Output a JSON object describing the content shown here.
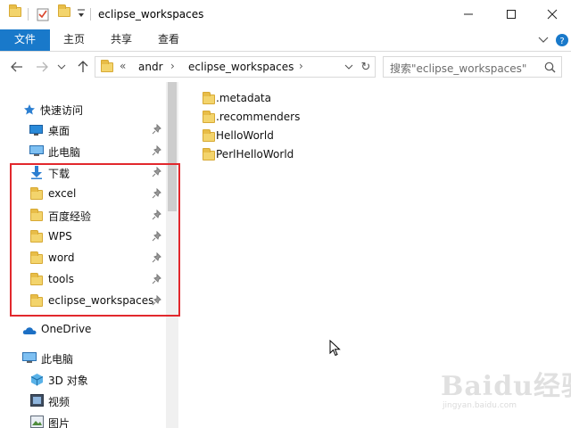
{
  "window": {
    "title": "eclipse_workspaces",
    "minimize_glyph": "—",
    "maximize_glyph": "☐",
    "close_glyph": "✕"
  },
  "ribbon": {
    "tabs": [
      "文件",
      "主页",
      "共享",
      "查看"
    ],
    "active_tab": "文件",
    "file_tab_color": "#1979ca"
  },
  "address": {
    "overflow_glyph": "«",
    "crumbs": [
      "andr",
      "eclipse_workspaces"
    ],
    "separator": "›",
    "refresh_glyph": "↻"
  },
  "search": {
    "placeholder": "搜索\"eclipse_workspaces\""
  },
  "nav_pane": {
    "quick_access_label": "快速访问",
    "quick_access_items": [
      {
        "label": "桌面",
        "icon": "desktop-icon",
        "pinned": true
      },
      {
        "label": "此电脑",
        "icon": "computer-icon",
        "pinned": true
      },
      {
        "label": "下载",
        "icon": "download-icon",
        "pinned": true
      },
      {
        "label": "excel",
        "icon": "folder-icon",
        "pinned": true
      },
      {
        "label": "百度经验",
        "icon": "folder-icon",
        "pinned": true
      },
      {
        "label": "WPS",
        "icon": "folder-icon",
        "pinned": true
      },
      {
        "label": "word",
        "icon": "folder-icon",
        "pinned": true
      },
      {
        "label": "tools",
        "icon": "folder-icon",
        "pinned": true
      },
      {
        "label": "eclipse_workspaces",
        "icon": "folder-icon",
        "pinned": true
      }
    ],
    "onedrive_label": "OneDrive",
    "this_pc_label": "此电脑",
    "this_pc_items": [
      {
        "label": "3D 对象",
        "icon": "3d-objects-icon"
      },
      {
        "label": "视频",
        "icon": "video-icon"
      },
      {
        "label": "图片",
        "icon": "pictures-icon"
      }
    ]
  },
  "content": {
    "items": [
      ".metadata",
      ".recommenders",
      "HelloWorld",
      "PerlHelloWorld"
    ]
  },
  "annotation": {
    "highlight_color": "#e2282d"
  },
  "watermark": {
    "main": "Baidu经验",
    "sub": "jingyan.baidu.com"
  }
}
